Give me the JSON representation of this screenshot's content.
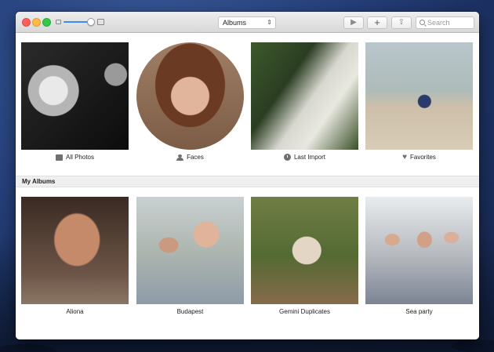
{
  "toolbar": {
    "view_select": "Albums",
    "search_placeholder": "Search",
    "play_icon": "play-icon",
    "add_icon": "plus-icon",
    "share_icon": "share-icon"
  },
  "top_albums": [
    {
      "label": "All Photos",
      "icon": "photos-icon"
    },
    {
      "label": "Faces",
      "icon": "person-icon"
    },
    {
      "label": "Last Import",
      "icon": "clock-icon"
    },
    {
      "label": "Favorites",
      "icon": "heart-icon"
    }
  ],
  "section_title": "My Albums",
  "my_albums": [
    {
      "label": "Aliona"
    },
    {
      "label": "Budapest"
    },
    {
      "label": "Gemini Duplicates"
    },
    {
      "label": "Sea party"
    }
  ],
  "colors": {
    "close": "#fc605c",
    "minimize": "#fdbc40",
    "maximize": "#34c84a",
    "accent": "#3b8df5"
  }
}
